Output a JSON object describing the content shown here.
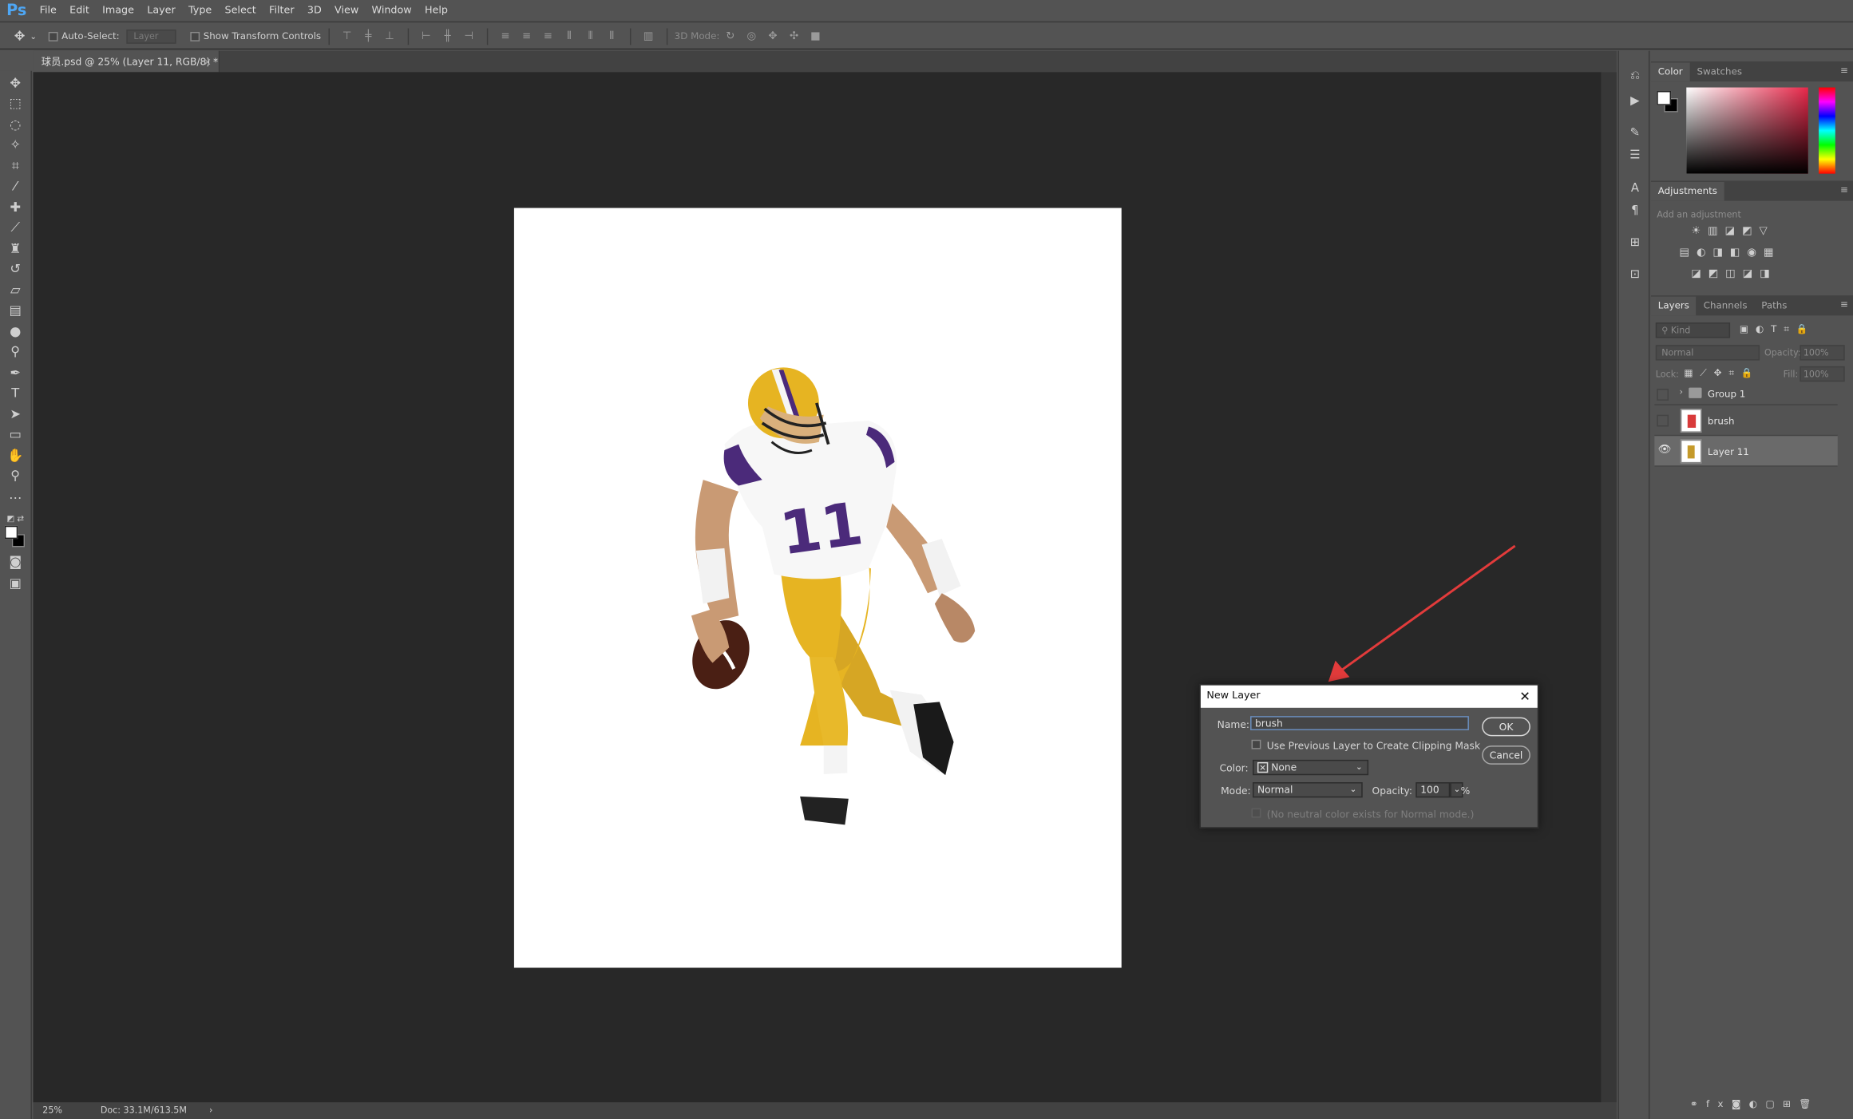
{
  "app": {
    "logo": "Ps"
  },
  "menu": [
    "File",
    "Edit",
    "Image",
    "Layer",
    "Type",
    "Select",
    "Filter",
    "3D",
    "View",
    "Window",
    "Help"
  ],
  "options": {
    "auto_select_label": "Auto-Select:",
    "auto_select_value": "Layer",
    "transform_label": "Show Transform Controls",
    "mode3d_label": "3D Mode:"
  },
  "document": {
    "tab_title": "球员.psd @ 25% (Layer 11, RGB/8) *",
    "close": "×"
  },
  "status": {
    "zoom": "25%",
    "doc": "Doc: 33.1M/613.5M",
    "arrow": "›"
  },
  "color_panel": {
    "tabs": [
      "Color",
      "Swatches"
    ]
  },
  "adjustments": {
    "title": "Adjustments",
    "hint": "Add an adjustment"
  },
  "layers_panel": {
    "tabs": [
      "Layers",
      "Channels",
      "Paths"
    ],
    "kind_placeholder": "Kind",
    "blend_mode": "Normal",
    "opacity_label": "Opacity:",
    "opacity_value": "100%",
    "lock_label": "Lock:",
    "fill_label": "Fill:",
    "fill_value": "100%",
    "layers": [
      {
        "name": "Group 1",
        "type": "group",
        "visible": false
      },
      {
        "name": "brush",
        "type": "layer",
        "visible": false
      },
      {
        "name": "Layer 11",
        "type": "layer",
        "visible": true,
        "selected": true
      }
    ]
  },
  "dialog": {
    "title": "New Layer",
    "close": "✕",
    "name_label": "Name:",
    "name_value": "brush",
    "clip_label": "Use Previous Layer to Create Clipping Mask",
    "color_label": "Color:",
    "color_value": "None",
    "mode_label": "Mode:",
    "mode_value": "Normal",
    "opacity_label": "Opacity:",
    "opacity_value": "100",
    "percent": "%",
    "neutral_label": "(No neutral color exists for Normal mode.)",
    "ok": "OK",
    "cancel": "Cancel"
  },
  "colors": {
    "annotation_arrow": "#e23b3b",
    "jersey_purple": "#4b2a7a",
    "jersey_gold": "#e6b422"
  }
}
